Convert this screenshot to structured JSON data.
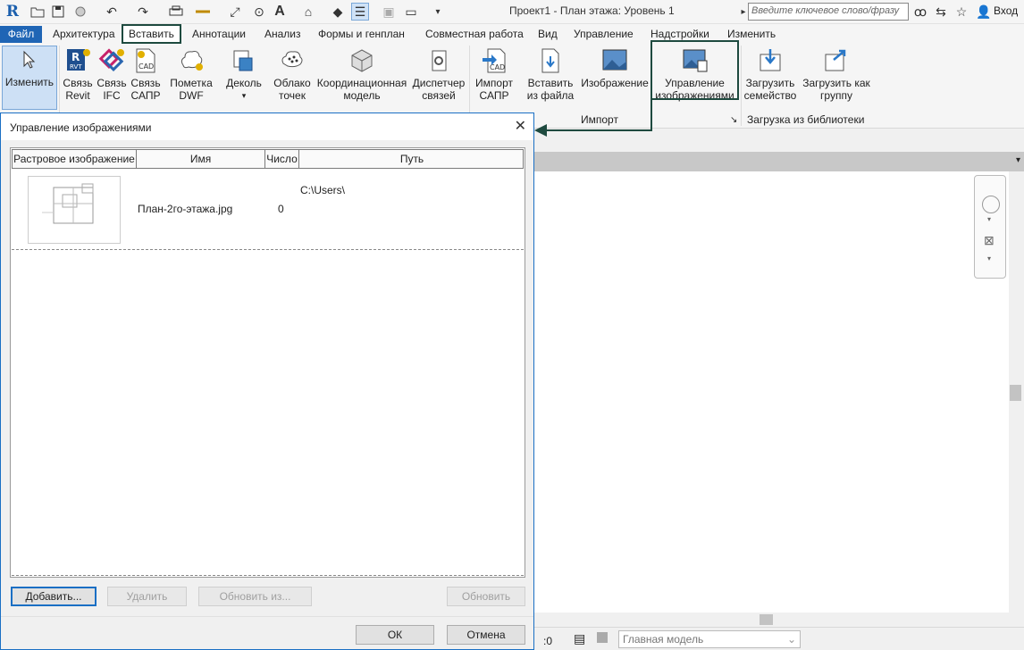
{
  "app": {
    "title": "Проект1 - План этажа: Уровень 1",
    "search_placeholder": "Введите ключевое слово/фразу",
    "login": "Вход",
    "logo": "R"
  },
  "tabs": [
    {
      "label": "Файл"
    },
    {
      "label": "Архитектура"
    },
    {
      "label": "Вставить"
    },
    {
      "label": "Аннотации"
    },
    {
      "label": "Анализ"
    },
    {
      "label": "Формы и генплан"
    },
    {
      "label": "Совместная работа"
    },
    {
      "label": "Вид"
    },
    {
      "label": "Управление"
    },
    {
      "label": "Надстройки"
    },
    {
      "label": "Изменить"
    }
  ],
  "ribbon": {
    "modify": "Изменить",
    "link_revit": [
      "Связь",
      "Revit"
    ],
    "link_ifc": [
      "Связь",
      "IFC"
    ],
    "link_cad": [
      "Связь",
      "САПР"
    ],
    "dwf_markup": [
      "Пометка",
      "DWF"
    ],
    "decal": [
      "Деколь"
    ],
    "point_cloud": [
      "Облако",
      "точек"
    ],
    "coord_model": [
      "Координационная",
      "модель"
    ],
    "manage_links": [
      "Диспетчер",
      "связей"
    ],
    "import_cad": [
      "Импорт",
      "САПР"
    ],
    "insert_file": [
      "Вставить",
      "из файла"
    ],
    "image": [
      "Изображение"
    ],
    "manage_images": [
      "Управление",
      "изображениями"
    ],
    "load_family": [
      "Загрузить",
      "семейство"
    ],
    "load_group": [
      "Загрузить как",
      "группу"
    ],
    "panel_import": "Импорт",
    "panel_load": "Загрузка из библиотеки"
  },
  "dialog": {
    "title": "Управление изображениями",
    "columns": [
      "Растровое изображение",
      "Имя",
      "Число",
      "Путь"
    ],
    "rows": [
      {
        "name": "План-2го-этажа.jpg",
        "count": "0",
        "path": "C:\\Users\\"
      }
    ],
    "buttons": {
      "add": "Добавить...",
      "delete": "Удалить",
      "update_from": "Обновить из...",
      "update": "Обновить",
      "ok": "ОК",
      "cancel": "Отмена"
    }
  },
  "status": {
    "zero": ":0",
    "model": "Главная модель"
  },
  "colors": {
    "file_tab": "#1f65b5",
    "callout": "#1e4a3f",
    "dialog_border": "#1a6fc4"
  }
}
